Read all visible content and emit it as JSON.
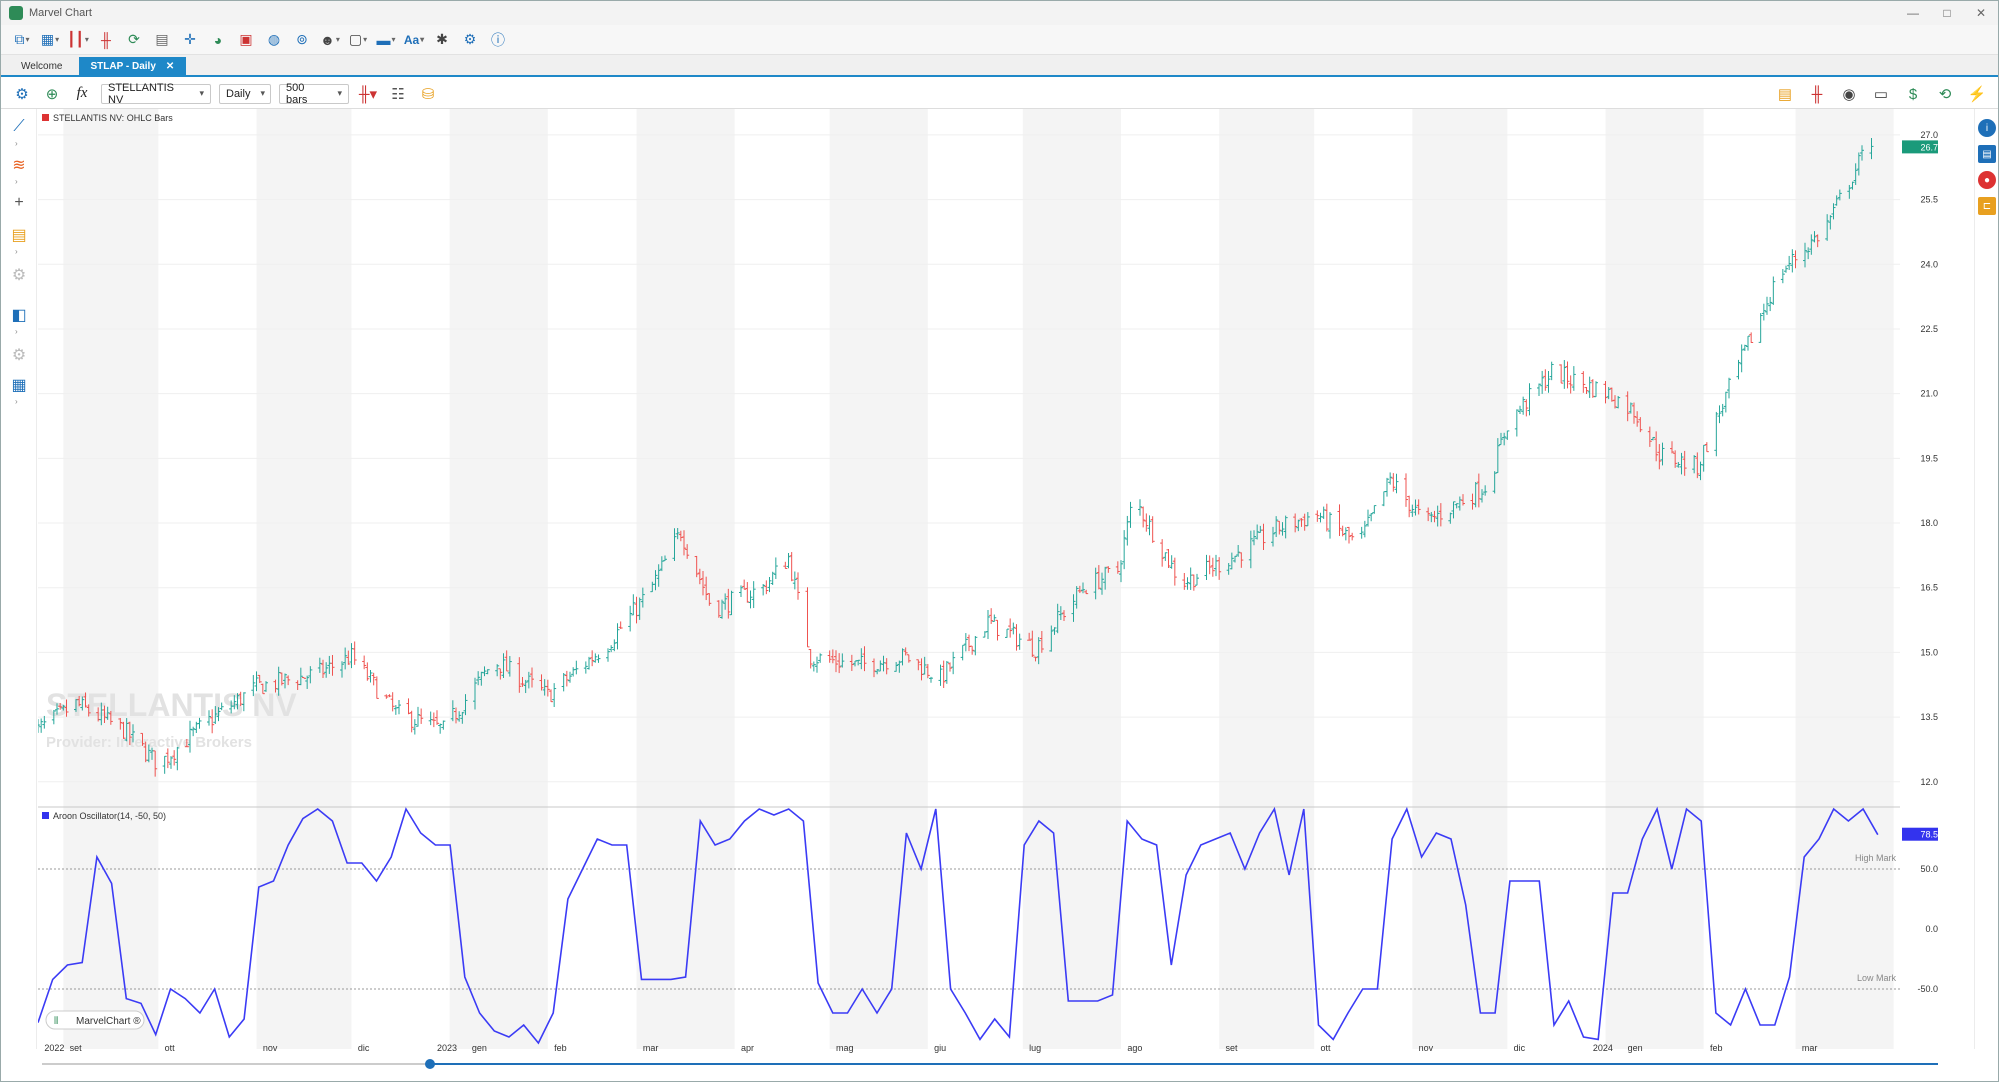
{
  "app": {
    "title": "Marvel Chart"
  },
  "tabs": [
    {
      "label": "Welcome"
    },
    {
      "label": "STLAP - Daily"
    }
  ],
  "toolbar": {
    "symbol": "STELLANTIS NV",
    "period": "Daily",
    "bars": "500 bars"
  },
  "price_pane": {
    "label": "STELLANTIS NV: OHLC Bars",
    "watermark_title": "STELLANTIS NV",
    "watermark_sub": "Provider: Interactive Brokers",
    "last_price": "26.710",
    "axis_labels": [
      "27.000",
      "25.500",
      "24.000",
      "22.500",
      "21.000",
      "19.500",
      "18.000",
      "16.500",
      "15.000",
      "13.500",
      "12.000"
    ]
  },
  "osc_pane": {
    "label": "Aroon Oscillator(14, -50, 50)",
    "last_value": "78.571",
    "high_mark": "High Mark",
    "low_mark": "Low Mark",
    "axis_labels": [
      "50.000",
      "0.000",
      "-50.000"
    ]
  },
  "xaxis": {
    "labels": [
      "2022",
      "set",
      "ott",
      "nov",
      "dic",
      "2023",
      "gen",
      "feb",
      "mar",
      "apr",
      "mag",
      "giu",
      "lug",
      "ago",
      "set",
      "ott",
      "nov",
      "dic",
      "2024",
      "gen",
      "feb",
      "mar"
    ]
  },
  "badge": {
    "label": "MarvelChart ®"
  },
  "colors": {
    "up": "#26a69a",
    "down": "#ef5350",
    "accent": "#1e88c8",
    "osc": "#3b3bf5",
    "price_tag": "#1a9a7a",
    "osc_tag": "#3333ee"
  },
  "chart_data": [
    {
      "type": "ohlc",
      "title": "STELLANTIS NV: OHLC Bars",
      "ylim": [
        11.6,
        27.6
      ],
      "anchors_x": [
        "2022-08-20",
        "2022-09-05",
        "2022-09-20",
        "2022-10-01",
        "2022-10-15",
        "2022-11-01",
        "2022-11-20",
        "2022-12-01",
        "2022-12-15",
        "2022-12-30",
        "2023-01-15",
        "2023-02-01",
        "2023-02-20",
        "2023-03-05",
        "2023-03-15",
        "2023-03-25",
        "2023-04-10",
        "2023-04-18",
        "2023-04-25",
        "2023-05-10",
        "2023-05-25",
        "2023-06-05",
        "2023-06-20",
        "2023-07-05",
        "2023-07-20",
        "2023-07-31",
        "2023-08-05",
        "2023-08-20",
        "2023-09-05",
        "2023-09-20",
        "2023-10-02",
        "2023-10-15",
        "2023-10-25",
        "2023-11-05",
        "2023-11-25",
        "2023-12-01",
        "2023-12-15",
        "2024-01-02",
        "2024-01-10",
        "2024-01-18",
        "2024-01-30",
        "2024-02-10",
        "2024-02-25",
        "2024-03-10",
        "2024-03-25"
      ],
      "anchors_close": [
        13.0,
        13.8,
        13.2,
        12.4,
        13.3,
        14.2,
        14.5,
        14.9,
        13.6,
        13.2,
        14.8,
        14.0,
        15.2,
        16.4,
        17.8,
        16.0,
        16.5,
        17.2,
        14.9,
        14.7,
        14.9,
        14.4,
        15.7,
        15.1,
        16.5,
        16.9,
        18.6,
        16.6,
        17.2,
        17.9,
        18.2,
        17.5,
        19.0,
        18.0,
        18.9,
        20.3,
        21.5,
        21.0,
        20.6,
        19.6,
        19.3,
        21.3,
        23.8,
        24.8,
        26.9
      ],
      "last": 26.71
    },
    {
      "type": "line",
      "title": "Aroon Oscillator(14, -50, 50)",
      "ylim": [
        -100,
        100
      ],
      "high_mark": 50,
      "low_mark": -50,
      "series": [
        {
          "values": [
            -78,
            -42,
            -30,
            -28,
            60,
            38,
            -58,
            -62,
            -88,
            -50,
            -58,
            -70,
            -50,
            -90,
            -75,
            35,
            40,
            70,
            92,
            100,
            90,
            55,
            55,
            40,
            60,
            100,
            80,
            70,
            70,
            -40,
            -70,
            -85,
            -90,
            -80,
            -95,
            -70,
            25,
            50,
            75,
            70,
            70,
            -42,
            -42,
            -42,
            -40,
            90,
            70,
            75,
            90,
            100,
            95,
            100,
            90,
            -45,
            -70,
            -70,
            -50,
            -70,
            -50,
            80,
            50,
            100,
            -50,
            -70,
            -92,
            -75,
            -90,
            70,
            90,
            80,
            -60,
            -60,
            -60,
            -55,
            90,
            75,
            70,
            -30,
            45,
            70,
            75,
            80,
            50,
            80,
            100,
            45,
            100,
            -80,
            -92,
            -70,
            -50,
            -50,
            75,
            100,
            60,
            80,
            75,
            20,
            -70,
            -70,
            40,
            40,
            40,
            -80,
            -60,
            -90,
            -92,
            30,
            30,
            75,
            100,
            50,
            100,
            90,
            -70,
            -80,
            -50,
            -80,
            -80,
            -40,
            60,
            75,
            100,
            90,
            100,
            78.571
          ]
        }
      ]
    }
  ]
}
